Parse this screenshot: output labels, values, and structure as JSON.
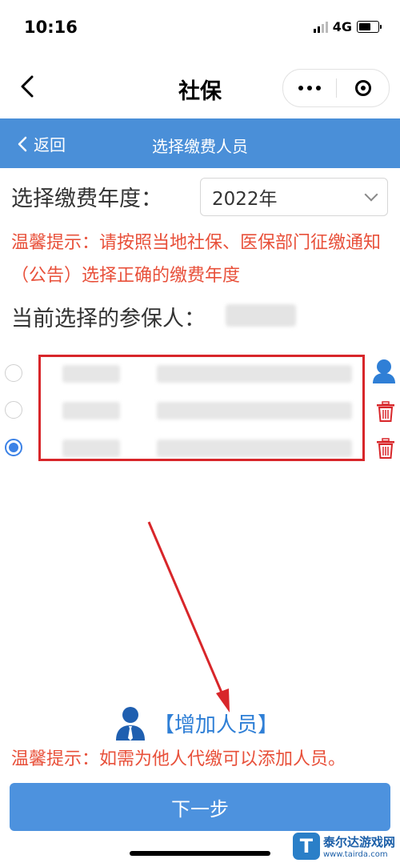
{
  "status_bar": {
    "time": "10:16",
    "network": "4G"
  },
  "nav": {
    "title": "社保"
  },
  "header": {
    "back_label": "返回",
    "title": "选择缴费人员"
  },
  "year": {
    "label": "选择缴费年度：",
    "selected": "2022年"
  },
  "tips": {
    "tip1": "温馨提示：请按照当地社保、医保部门征缴通知（公告）选择正确的缴费年度",
    "tip2": "温馨提示：如需为他人代缴可以添加人员。"
  },
  "current": {
    "label": "当前选择的参保人："
  },
  "persons": [
    {
      "selected": false,
      "action": "user-icon"
    },
    {
      "selected": false,
      "action": "trash-icon"
    },
    {
      "selected": true,
      "action": "trash-icon"
    }
  ],
  "add_person": {
    "label": "【增加人员】"
  },
  "next_button": {
    "label": "下一步"
  },
  "watermark": {
    "name": "泰尔达游戏网",
    "url": "www.tairda.com"
  },
  "colors": {
    "accent": "#4a8fd8",
    "tip": "#e8503a",
    "link": "#2f7fd6",
    "danger": "#d8262a"
  }
}
